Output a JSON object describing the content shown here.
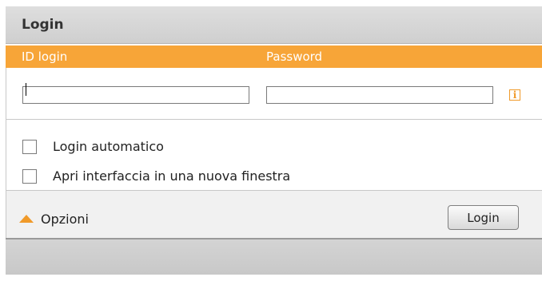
{
  "window": {
    "title": "Login"
  },
  "labels": {
    "id_login": "ID login",
    "password": "Password"
  },
  "fields": {
    "id_value": "",
    "password_value": ""
  },
  "info_icon": {
    "glyph": "i",
    "icon": "info-icon"
  },
  "options": [
    {
      "label": "Login automatico",
      "checked": false
    },
    {
      "label": "Apri interfaccia in una nuova finestra",
      "checked": false
    }
  ],
  "footer": {
    "options_label": "Opzioni",
    "login_button": "Login"
  },
  "colors": {
    "accent": "#f7a538",
    "icon_orange": "#f09a2a",
    "header": "#d6d6d6"
  }
}
